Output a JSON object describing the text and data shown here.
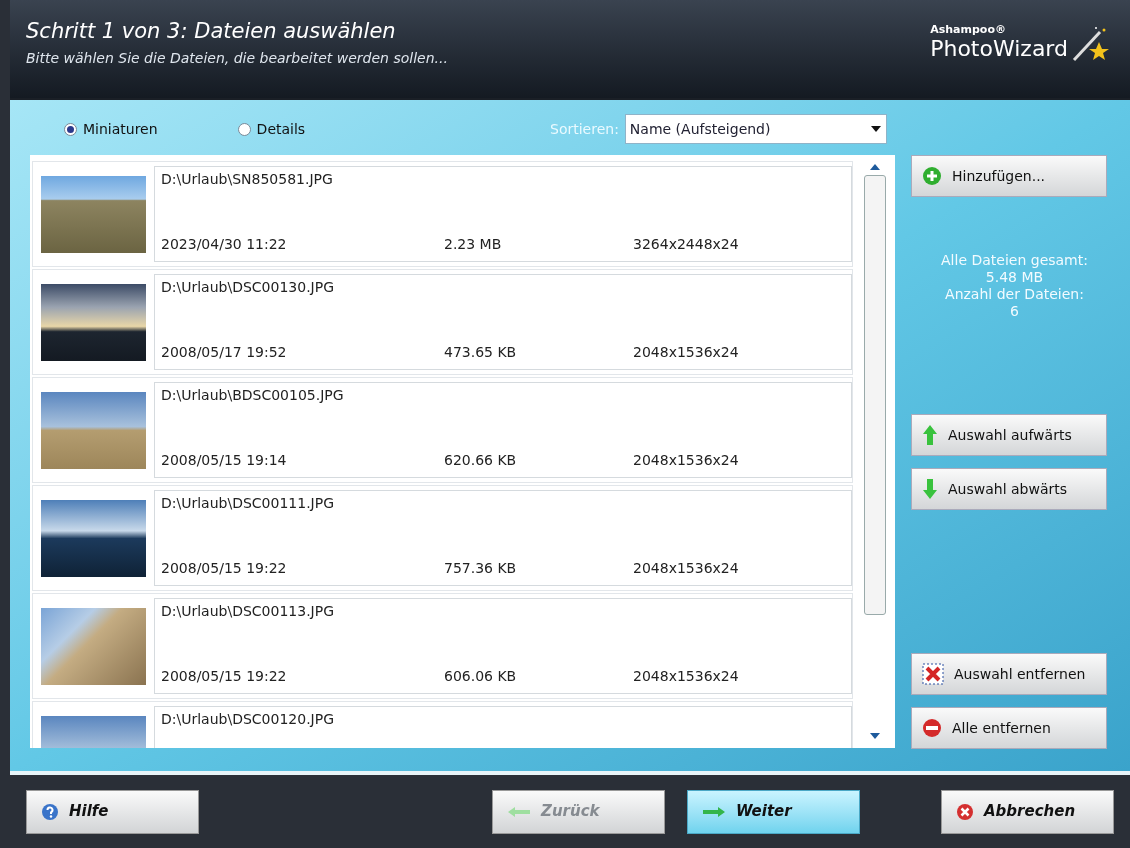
{
  "header": {
    "title": "Schritt 1 von 3: Dateien auswählen",
    "subtitle": "Bitte wählen Sie die Dateien, die bearbeitet werden sollen...",
    "brand_small": "Ashampoo®",
    "brand_large": "PhotoWizard"
  },
  "view_options": [
    {
      "label": "Miniaturen",
      "selected": true
    },
    {
      "label": "Details",
      "selected": false
    }
  ],
  "sort": {
    "label": "Sortieren:",
    "value": "Name (Aufsteigend)"
  },
  "files": [
    {
      "path": "D:\\Urlaub\\SN850581.JPG",
      "date": "2023/04/30 11:22",
      "size": "2.23 MB",
      "dimensions": "3264x2448x24"
    },
    {
      "path": "D:\\Urlaub\\DSC00130.JPG",
      "date": "2008/05/17 19:52",
      "size": "473.65 KB",
      "dimensions": "2048x1536x24"
    },
    {
      "path": "D:\\Urlaub\\BDSC00105.JPG",
      "date": "2008/05/15 19:14",
      "size": "620.66 KB",
      "dimensions": "2048x1536x24"
    },
    {
      "path": "D:\\Urlaub\\DSC00111.JPG",
      "date": "2008/05/15 19:22",
      "size": "757.36 KB",
      "dimensions": "2048x1536x24"
    },
    {
      "path": "D:\\Urlaub\\DSC00113.JPG",
      "date": "2008/05/15 19:22",
      "size": "606.06 KB",
      "dimensions": "2048x1536x24"
    },
    {
      "path": "D:\\Urlaub\\DSC00120.JPG"
    }
  ],
  "side_buttons": [
    {
      "label": "Hinzufügen...",
      "kind": "add"
    },
    {
      "label": "Auswahl aufwärts",
      "kind": "up"
    },
    {
      "label": "Auswahl abwärts",
      "kind": "down"
    },
    {
      "label": "Auswahl entfernen",
      "kind": "remove"
    },
    {
      "label": "Alle entfernen",
      "kind": "clear"
    }
  ],
  "summary": [
    "Alle Dateien gesamt:",
    "5.48 MB",
    "Anzahl der Dateien:",
    "6"
  ],
  "footer_buttons": [
    {
      "label": "Hilfe",
      "kind": "help",
      "disabled": false,
      "selected": false
    },
    {
      "label": "Zurück",
      "kind": "back",
      "disabled": true,
      "selected": false
    },
    {
      "label": "Weiter",
      "kind": "next",
      "disabled": false,
      "selected": true
    },
    {
      "label": "Abbrechen",
      "kind": "cancel",
      "disabled": false,
      "selected": false
    }
  ]
}
